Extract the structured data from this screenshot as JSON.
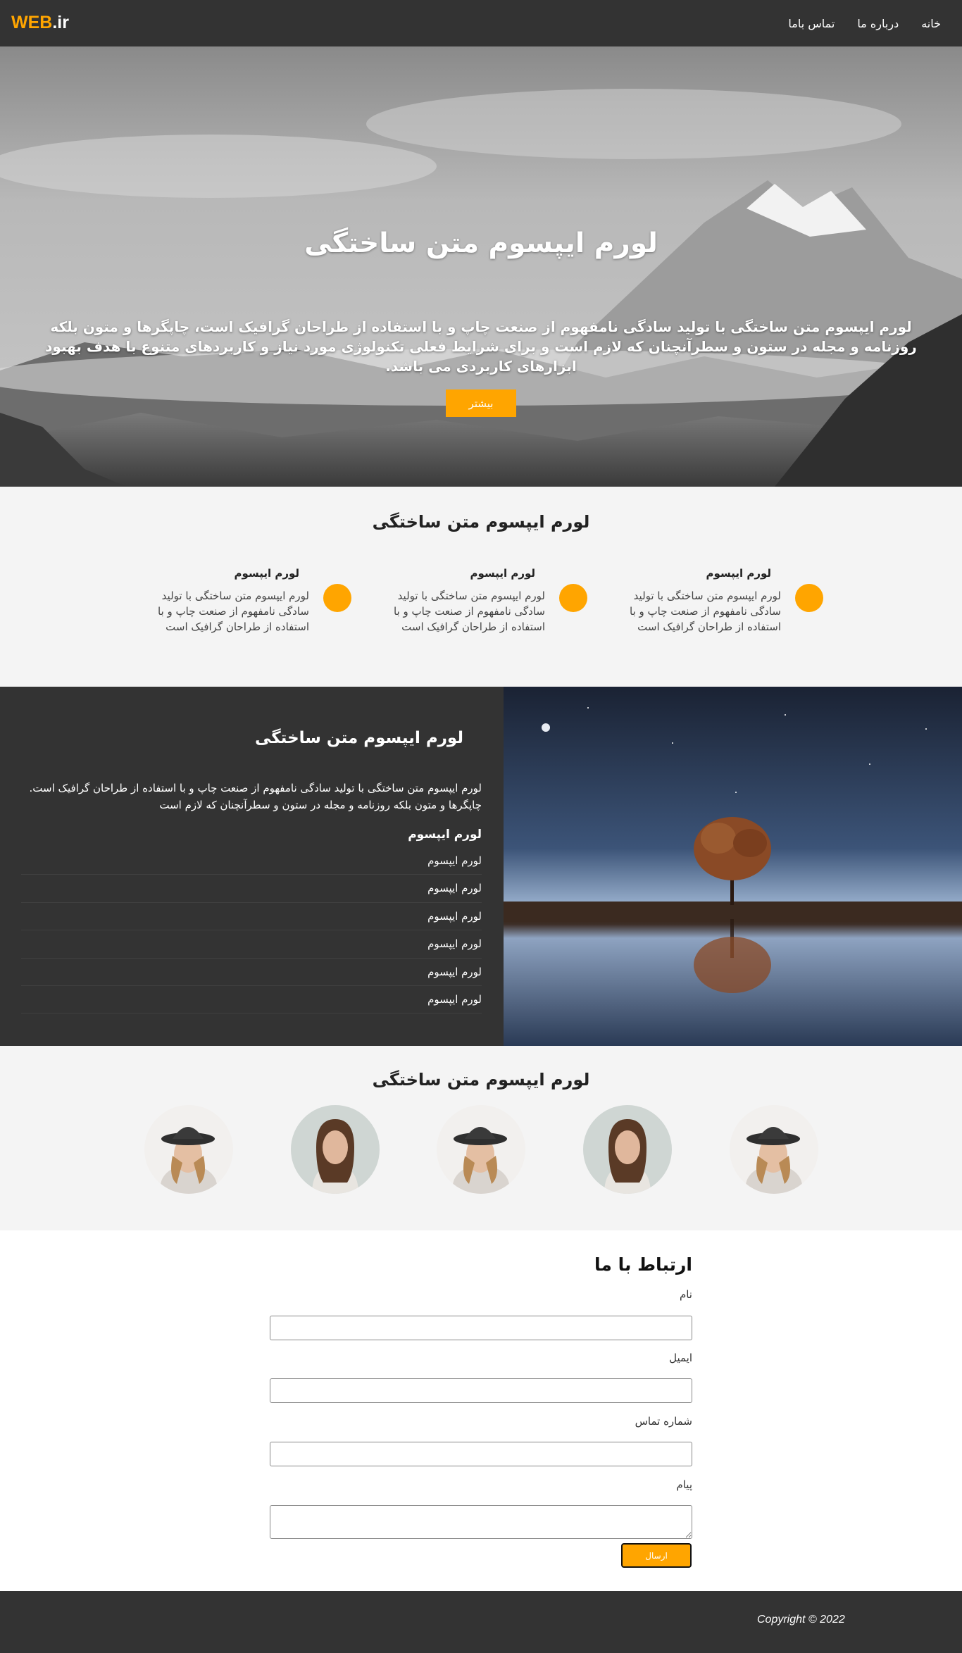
{
  "navbar": {
    "logo_part1": "WEB",
    "logo_part2": ".ir",
    "links": [
      "خانه",
      "درباره ما",
      "تماس باما"
    ]
  },
  "hero": {
    "title": "لورم ایپسوم متن ساختگی",
    "text": "لورم ایپسوم متن ساختگی با تولید سادگی نامفهوم از صنعت چاپ و با استفاده از طراحان گرافیک است، چاپگرها و متون بلکه روزنامه و مجله در ستون و سطرآنچنان که لازم است و برای شرایط فعلی تکنولوژی مورد نیاز و کاربردهای متنوع با هدف بهبود ابزارهای کاربردی می باشد.",
    "button_label": "بیشتر"
  },
  "features": {
    "title": "لورم ایپسوم متن ساختگی",
    "items": [
      {
        "title": "لورم ایپسوم",
        "desc": "لورم ایپسوم متن ساختگی با تولید سادگی نامفهوم از صنعت چاپ و با استفاده از طراحان گرافیک است"
      },
      {
        "title": "لورم ایپسوم",
        "desc": "لورم ایپسوم متن ساختگی با تولید سادگی نامفهوم از صنعت چاپ و با استفاده از طراحان گرافیک است"
      },
      {
        "title": "لورم ایپسوم",
        "desc": "لورم ایپسوم متن ساختگی با تولید سادگی نامفهوم از صنعت چاپ و با استفاده از طراحان گرافیک است"
      }
    ]
  },
  "about": {
    "title": "لورم ایپسوم متن ساختگی",
    "text": "لورم ایپسوم متن ساختگی با تولید سادگی نامفهوم از صنعت چاپ و با استفاده از طراحان گرافیک است. چاپگرها و متون بلکه روزنامه و مجله در ستون و سطرآنچنان که لازم است",
    "subtitle": "لورم ایپسوم",
    "list": [
      "لورم ایپسوم",
      "لورم ایپسوم",
      "لورم ایپسوم",
      "لورم ایپسوم",
      "لورم ایپسوم",
      "لورم ایپسوم"
    ]
  },
  "team": {
    "title": "لورم ایپسوم متن ساختگی"
  },
  "contact": {
    "title": "ارتباط با ما",
    "name_label": "نام",
    "email_label": "ایمیل",
    "phone_label": "شماره تماس",
    "message_label": "پیام",
    "submit_label": "ارسال"
  },
  "footer": {
    "copyright": "Copyright © 2022"
  },
  "colors": {
    "accent": "#ffa500",
    "dark": "#333333",
    "light_bg": "#f4f4f4"
  }
}
